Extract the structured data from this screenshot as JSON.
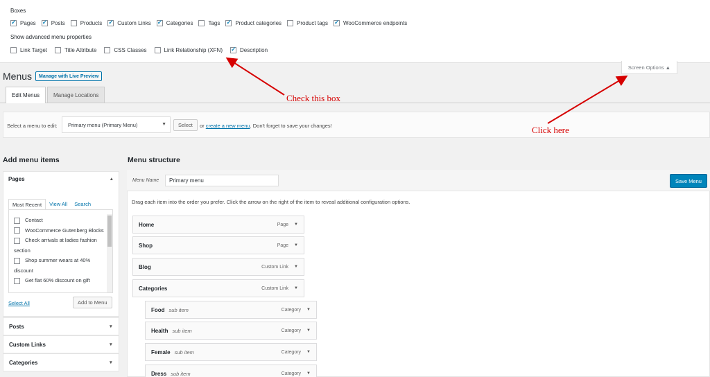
{
  "screen_options": {
    "boxes_heading": "Boxes",
    "boxes": [
      {
        "label": "Pages",
        "checked": true
      },
      {
        "label": "Posts",
        "checked": true
      },
      {
        "label": "Products",
        "checked": false
      },
      {
        "label": "Custom Links",
        "checked": true
      },
      {
        "label": "Categories",
        "checked": true
      },
      {
        "label": "Tags",
        "checked": false
      },
      {
        "label": "Product categories",
        "checked": true
      },
      {
        "label": "Product tags",
        "checked": false
      },
      {
        "label": "WooCommerce endpoints",
        "checked": true
      }
    ],
    "advanced_heading": "Show advanced menu properties",
    "advanced": [
      {
        "label": "Link Target",
        "checked": false
      },
      {
        "label": "Title Attribute",
        "checked": false
      },
      {
        "label": "CSS Classes",
        "checked": false
      },
      {
        "label": "Link Relationship (XFN)",
        "checked": false
      },
      {
        "label": "Description",
        "checked": true
      }
    ],
    "tab_label": "Screen Options ▲"
  },
  "header": {
    "title": "Menus",
    "live_preview": "Manage with Live Preview",
    "tabs": [
      "Edit Menus",
      "Manage Locations"
    ]
  },
  "select_menu": {
    "label": "Select a menu to edit:",
    "selected": "Primary menu (Primary Menu)",
    "button": "Select",
    "or": "or",
    "create_link": "create a new menu",
    "reminder": ". Don't forget to save your changes!"
  },
  "annotations": {
    "check_box": "Check this box",
    "click_here": "Click here"
  },
  "add_items": {
    "heading": "Add menu items",
    "pages_title": "Pages",
    "tabs": [
      "Most Recent",
      "View All",
      "Search"
    ],
    "pages": [
      "Contact",
      "WooCommerce Gutenberg Blocks",
      "Check arrivals at ladies fashion section",
      "Shop summer wears at 40% discount",
      "Get flat 60% discount on gift"
    ],
    "select_all": "Select All",
    "add_button": "Add to Menu",
    "sections": [
      "Posts",
      "Custom Links",
      "Categories"
    ]
  },
  "structure": {
    "heading": "Menu structure",
    "name_label": "Menu Name",
    "name_value": "Primary menu",
    "save_button": "Save Menu",
    "instructions": "Drag each item into the order you prefer. Click the arrow on the right of the item to reveal additional configuration options.",
    "items": [
      {
        "title": "Home",
        "sub": "",
        "type": "Page"
      },
      {
        "title": "Shop",
        "sub": "",
        "type": "Page"
      },
      {
        "title": "Blog",
        "sub": "",
        "type": "Custom Link"
      },
      {
        "title": "Categories",
        "sub": "",
        "type": "Custom Link"
      },
      {
        "title": "Food",
        "sub": "sub item",
        "type": "Category"
      },
      {
        "title": "Health",
        "sub": "sub item",
        "type": "Category"
      },
      {
        "title": "Female",
        "sub": "sub item",
        "type": "Category"
      },
      {
        "title": "Dress",
        "sub": "sub item",
        "type": "Category"
      }
    ]
  },
  "colors": {
    "accent": "#0085ba",
    "link": "#0073aa",
    "annotation": "#d60000"
  }
}
